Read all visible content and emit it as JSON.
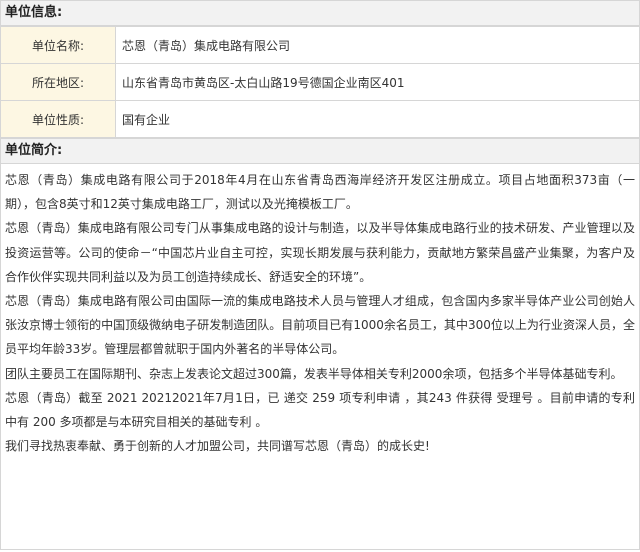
{
  "unit_info": {
    "header": "单位信息:",
    "rows": [
      {
        "label": "单位名称:",
        "value": "芯恩（青岛）集成电路有限公司"
      },
      {
        "label": "所在地区:",
        "value": "山东省青岛市黄岛区-太白山路19号德国企业南区401"
      },
      {
        "label": "单位性质:",
        "value": "国有企业"
      }
    ]
  },
  "unit_intro": {
    "header": "单位简介:",
    "paragraphs": [
      "芯恩（青岛）集成电路有限公司于2018年4月在山东省青岛西海岸经济开发区注册成立。项目占地面积373亩（一期），包含8英寸和12英寸集成电路工厂，测试以及光掩模板工厂。",
      "芯恩（青岛）集成电路有限公司专门从事集成电路的设计与制造，以及半导体集成电路行业的技术研发、产业管理以及投资运营等。公司的使命－“中国芯片业自主可控，实现长期发展与获利能力，贡献地方繁荣昌盛产业集聚，为客户及合作伙伴实现共同利益以及为员工创造持续成长、舒适安全的环境”。",
      "芯恩（青岛）集成电路有限公司由国际一流的集成电路技术人员与管理人才组成，包含国内多家半导体产业公司创始人张汝京博士领衔的中国顶级微纳电子研发制造团队。目前项目已有1000余名员工，其中300位以上为行业资深人员，全员平均年龄33岁。管理层都曾就职于国内外著名的半导体公司。",
      "团队主要员工在国际期刊、杂志上发表论文超过300篇，发表半导体相关专利2000余项，包括多个半导体基础专利。",
      "芯恩（青岛）截至 2021 20212021年7月1日，已 递交 259 项专利申请 ，其243 件获得 受理号 。目前申请的专利中有 200 多项都是与本研究目相关的基础专利 。",
      "我们寻找热衷奉献、勇于创新的人才加盟公司，共同谱写芯恩（青岛）的成长史!"
    ]
  }
}
